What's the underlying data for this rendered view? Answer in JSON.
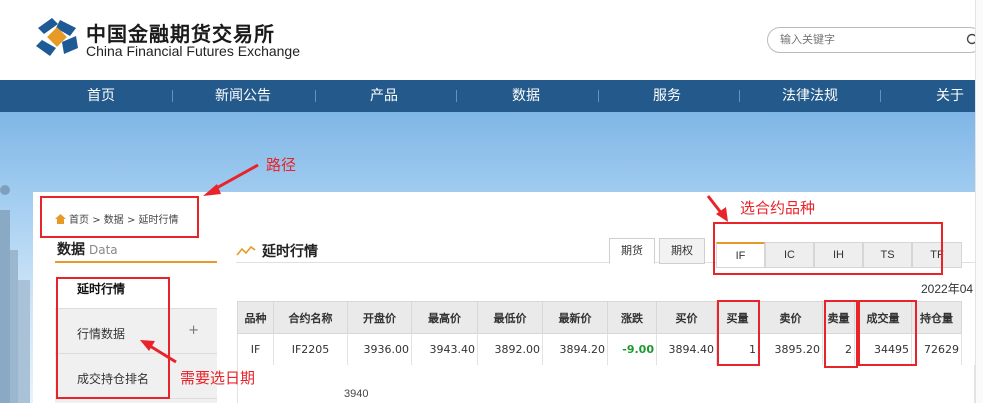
{
  "header": {
    "logo_cn": "中国金融期货交易所",
    "logo_en": "China Financial Futures Exchange",
    "search_placeholder": "输入关键字"
  },
  "nav": [
    "首页",
    "新闻公告",
    "产品",
    "数据",
    "服务",
    "法律法规",
    "关于"
  ],
  "breadcrumb": {
    "home": "首页",
    "sep1": ">",
    "data": "数据",
    "sep2": ">",
    "current": "延时行情"
  },
  "sidebar": {
    "title": "数据",
    "title_en": "Data",
    "items": [
      {
        "label": "延时行情",
        "expand": ""
      },
      {
        "label": "行情数据",
        "expand": "+"
      },
      {
        "label": "成交持仓排名",
        "expand": ""
      }
    ]
  },
  "section_title": "延时行情",
  "type_tabs": [
    "期货",
    "期权"
  ],
  "product_tabs": [
    "IF",
    "IC",
    "IH",
    "TS",
    "TF"
  ],
  "date_text": "2022年04",
  "table": {
    "headers": [
      "品种",
      "合约名称",
      "开盘价",
      "最高价",
      "最低价",
      "最新价",
      "涨跌",
      "买价",
      "买量",
      "卖价",
      "卖量",
      "成交量",
      "持仓量"
    ],
    "row": [
      "IF",
      "IF2205",
      "3936.00",
      "3943.40",
      "3892.00",
      "3894.20",
      "-9.00",
      "3894.40",
      "1",
      "3895.20",
      "2",
      "34495",
      "72629"
    ]
  },
  "chart_axis_label": "3940",
  "annotations": {
    "path": "路径",
    "contract": "选合约品种",
    "date": "需要选日期"
  },
  "colors": {
    "nav": "#23598b",
    "accent": "#e79a26",
    "annotation": "#e8232a",
    "down": "#1c9a2e"
  }
}
